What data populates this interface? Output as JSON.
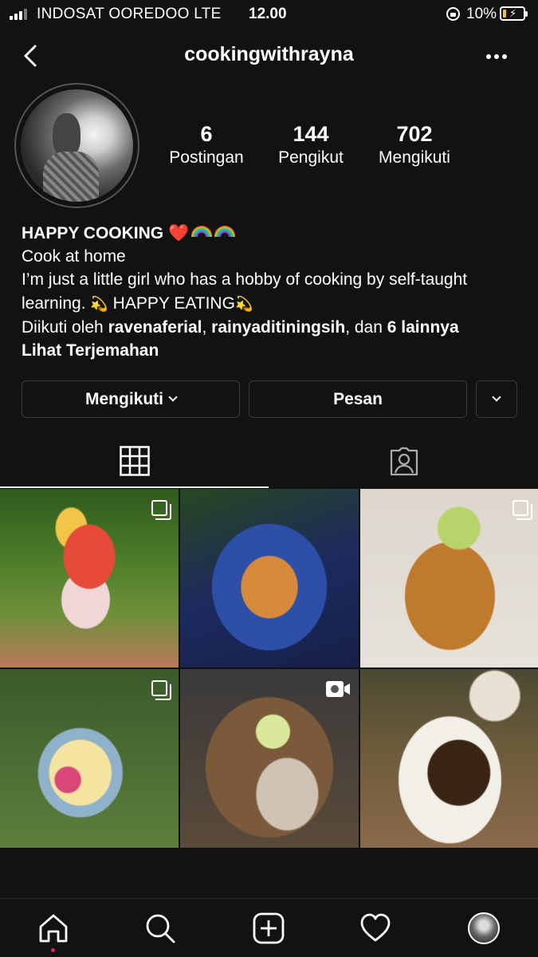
{
  "status_bar": {
    "carrier": "INDOSAT OOREDOO  LTE",
    "time": "12.00",
    "battery": "10%",
    "icons": [
      "signal-icon",
      "orientation-lock-icon",
      "battery-icon"
    ]
  },
  "header": {
    "username": "cookingwithrayna",
    "back_icon": "chevron-left-icon",
    "more_icon": "more-horizontal-icon"
  },
  "stats": {
    "posts": {
      "value": "6",
      "label": "Postingan"
    },
    "followers": {
      "value": "144",
      "label": "Pengikut"
    },
    "following": {
      "value": "702",
      "label": "Mengikuti"
    }
  },
  "bio": {
    "name": "HAPPY COOKING",
    "line1": "Cook at home",
    "line2a": "I’m just a little girl who has a hobby of cooking by self-taught learning.",
    "line2b": "HAPPY EATING",
    "followed_prefix": "Diikuti oleh",
    "followed_user1": "ravenaferial",
    "followed_sep": ",",
    "followed_user2": "rainyaditiningsih",
    "followed_and": ", dan",
    "followed_others": "6 lainnya",
    "translate": "Lihat Terjemahan"
  },
  "buttons": {
    "following": "Mengikuti",
    "message": "Pesan"
  },
  "tabs": [
    {
      "name": "grid",
      "icon": "grid-icon",
      "active": true
    },
    {
      "name": "tagged",
      "icon": "tagged-user-icon",
      "active": false
    }
  ],
  "posts": [
    {
      "type": "carousel",
      "icon": "multiple-photos-icon"
    },
    {
      "type": "photo"
    },
    {
      "type": "carousel",
      "icon": "multiple-photos-icon"
    },
    {
      "type": "carousel",
      "icon": "multiple-photos-icon"
    },
    {
      "type": "video",
      "icon": "video-camera-icon"
    },
    {
      "type": "photo"
    }
  ],
  "bottom_nav": [
    "home-icon",
    "search-icon",
    "new-post-icon",
    "activity-heart-icon",
    "profile-avatar"
  ],
  "colors": {
    "background": "#121212",
    "text": "#ffffff",
    "border": "#3a3a3a",
    "notification_dot": "#e0245e"
  }
}
